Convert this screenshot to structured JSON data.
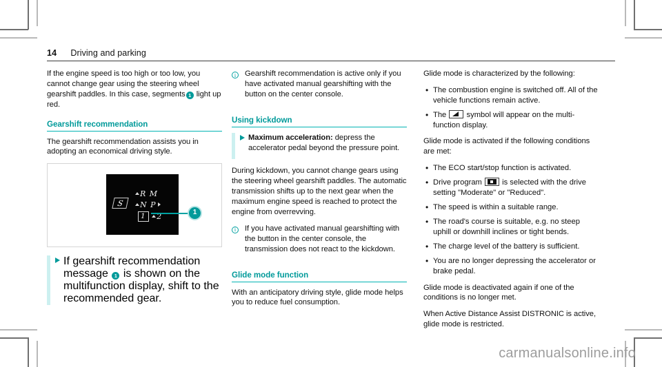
{
  "header": {
    "page_number": "14",
    "chapter": "Driving and parking"
  },
  "colors": {
    "accent_teal": "#009a9a",
    "rule_teal": "#00b3b3",
    "step_bar": "#ccf0f0",
    "callout_ring": "#b6e4e4"
  },
  "column_left": {
    "intro_paragraph": "If the engine speed is too high or too low, you cannot change gear using the steering wheel gearshift paddles. In this case, segments",
    "intro_paragraph_tail": "light up red.",
    "section_heading": "Gearshift recommendation",
    "section_paragraph": "The gearshift recommendation assists you in adopting an economical driving style.",
    "figure": {
      "name": "multifunction-display-gear-indicator",
      "screen_rows": {
        "row1": "R  M",
        "row2": "N  P",
        "row3_box": "1",
        "row3_rest": "2",
        "s_mode": "S"
      },
      "callout_number": "1"
    },
    "step": {
      "text_before": "If gearshift recommendation message",
      "callout": "1",
      "text_after": "is shown on the multifunction display, shift to the recommended gear."
    }
  },
  "column_middle": {
    "note_1": "Gearshift recommendation is active only if you have activated manual gearshifting with the button on the center console.",
    "section_heading": "Using kickdown",
    "step_bold": "Maximum acceleration:",
    "step_rest": "depress the accelerator pedal beyond the pressure point.",
    "paragraph_1": "During kickdown, you cannot change gears using the steering wheel gearshift paddles. The automatic transmission shifts up to the next gear when the maximum engine speed is reached to protect the engine from overrevving.",
    "note_2": "If you have activated manual gearshifting with the button in the center console, the transmission does not react to the kickdown.",
    "section_heading_2": "Glide mode function",
    "paragraph_2": "With an anticipatory driving style, glide mode helps you to reduce fuel consumption."
  },
  "column_right": {
    "lead_1": "Glide mode is characterized by the following:",
    "bullets_1": [
      {
        "text": "The combustion engine is switched off. All of the vehicle functions remain active.",
        "symbol": null
      },
      {
        "text_before": "The",
        "symbol": "glide-mode-symbol",
        "text_after": "symbol will appear on the multi-function display."
      }
    ],
    "lead_2": "Glide mode is activated if the following conditions are met:",
    "bullets_2": [
      {
        "text": "The ECO start/stop function is activated."
      },
      {
        "text_before": "Drive program",
        "symbol": "drive-program-symbol",
        "text_after": "is selected with the drive setting \"Moderate\" or \"Reduced\"."
      },
      {
        "text": "The speed is within a suitable range."
      },
      {
        "text": "The road's course is suitable, e.g. no steep uphill or downhill inclines or tight bends."
      },
      {
        "text": "The charge level of the battery is sufficient."
      },
      {
        "text": "You are no longer depressing the accelerator or brake pedal."
      }
    ],
    "closing_1": "Glide mode is deactivated again if one of the conditions is no longer met.",
    "closing_2": "When Active Distance Assist DISTRONIC is active, glide mode is restricted."
  },
  "watermark": "carmanualsonline.info"
}
